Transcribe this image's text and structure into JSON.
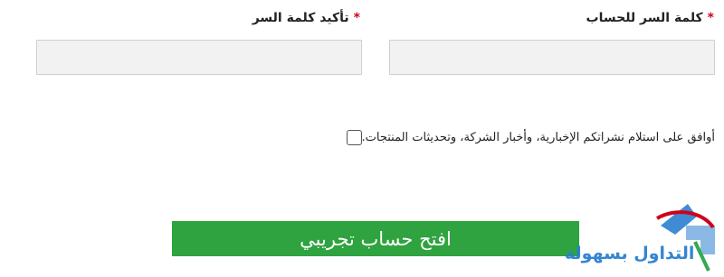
{
  "form": {
    "password": {
      "label": "كلمة السر للحساب",
      "required_mark": "*",
      "value": "",
      "placeholder": ""
    },
    "confirm_password": {
      "label": "تأكيد كلمة السر",
      "required_mark": "*",
      "value": "",
      "placeholder": ""
    },
    "newsletter_consent": {
      "checked": false,
      "label": "أوافق على استلام نشراتكم الإخبارية، وأخبار الشركة، وتحديثات المنتجات."
    },
    "submit": {
      "label": "افتح حساب تجريبي"
    }
  },
  "watermark": {
    "text": "التداول بسهولة",
    "colors": {
      "blue": "#2a7fd0",
      "red": "#d0021b",
      "green": "#35a853"
    }
  },
  "colors": {
    "required": "#d0021b",
    "button": "#2ea33f",
    "input_background": "#f2f2f2",
    "input_border": "#cfcfcf"
  }
}
